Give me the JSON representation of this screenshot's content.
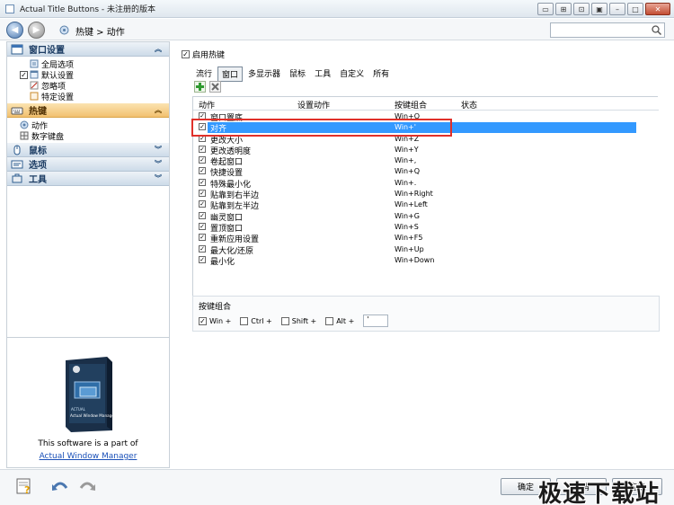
{
  "window": {
    "title": "Actual Title Buttons - 未注册的版本"
  },
  "nav": {
    "breadcrumb": "热键 > 动作",
    "search_placeholder": ""
  },
  "sidebar": {
    "groups": [
      {
        "label": "窗口设置",
        "items": [
          {
            "label": "全局选项"
          },
          {
            "label": "默认设置"
          },
          {
            "label": "忽略项"
          },
          {
            "label": "特定设置"
          }
        ]
      },
      {
        "label": "热键",
        "items": [
          {
            "label": "动作"
          },
          {
            "label": "数字键盘"
          }
        ]
      },
      {
        "label": "鼠标"
      },
      {
        "label": "选项"
      },
      {
        "label": "工具"
      }
    ],
    "promo_text": "This software is a part of",
    "promo_link": "Actual Window Manager",
    "product_box_text": "Actual Window Manager"
  },
  "main": {
    "enable_label": "启用热键",
    "filter_tabs": [
      "流行",
      "窗口",
      "多显示器",
      "鼠标",
      "工具",
      "自定义",
      "所有"
    ],
    "columns": {
      "action": "动作",
      "set_action": "设置动作",
      "key_combo": "按键组合",
      "state": "状态"
    },
    "rows": [
      {
        "name": "窗口置底",
        "key": "Win+O"
      },
      {
        "name": "对齐",
        "key": "Win+'"
      },
      {
        "name": "更改大小",
        "key": "Win+Z"
      },
      {
        "name": "更改透明度",
        "key": "Win+Y"
      },
      {
        "name": "卷起窗口",
        "key": "Win+,"
      },
      {
        "name": "快捷设置",
        "key": "Win+Q"
      },
      {
        "name": "特殊最小化",
        "key": "Win+."
      },
      {
        "name": "贴靠到右半边",
        "key": "Win+Right"
      },
      {
        "name": "贴靠到左半边",
        "key": "Win+Left"
      },
      {
        "name": "幽灵窗口",
        "key": "Win+G"
      },
      {
        "name": "置顶窗口",
        "key": "Win+S"
      },
      {
        "name": "重新应用设置",
        "key": "Win+F5"
      },
      {
        "name": "最大化/还原",
        "key": "Win+Up"
      },
      {
        "name": "最小化",
        "key": "Win+Down"
      }
    ],
    "combo": {
      "title": "按键组合",
      "win": "Win +",
      "ctrl": "Ctrl +",
      "shift": "Shift +",
      "alt": "Alt +",
      "key_value": "'"
    }
  },
  "bottom": {
    "ok": "确定",
    "cancel": "取消",
    "apply": "应用",
    "watermark": "极速下载站"
  }
}
